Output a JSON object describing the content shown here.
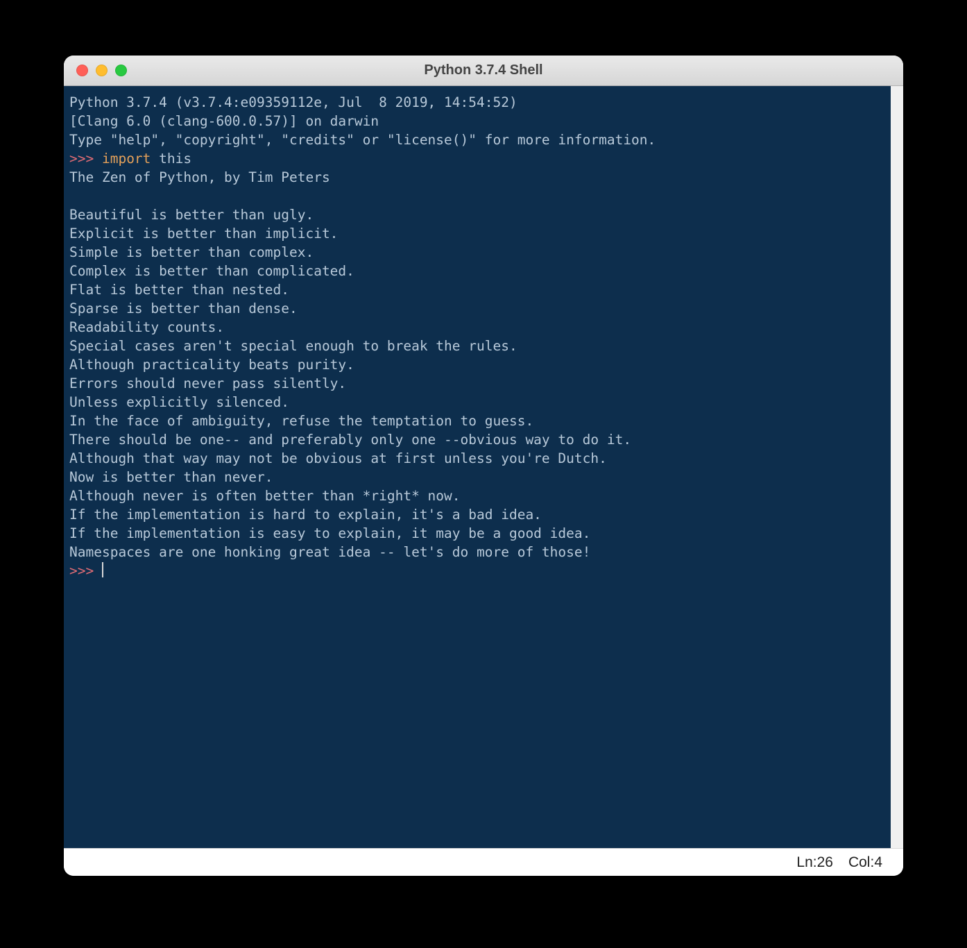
{
  "window": {
    "title": "Python 3.7.4 Shell"
  },
  "terminal": {
    "header": [
      "Python 3.7.4 (v3.7.4:e09359112e, Jul  8 2019, 14:54:52)",
      "[Clang 6.0 (clang-600.0.57)] on darwin",
      "Type \"help\", \"copyright\", \"credits\" or \"license()\" for more information."
    ],
    "prompt": ">>> ",
    "input_kw": "import",
    "input_rest": " this",
    "output": [
      "The Zen of Python, by Tim Peters",
      "",
      "Beautiful is better than ugly.",
      "Explicit is better than implicit.",
      "Simple is better than complex.",
      "Complex is better than complicated.",
      "Flat is better than nested.",
      "Sparse is better than dense.",
      "Readability counts.",
      "Special cases aren't special enough to break the rules.",
      "Although practicality beats purity.",
      "Errors should never pass silently.",
      "Unless explicitly silenced.",
      "In the face of ambiguity, refuse the temptation to guess.",
      "There should be one-- and preferably only one --obvious way to do it.",
      "Although that way may not be obvious at first unless you're Dutch.",
      "Now is better than never.",
      "Although never is often better than *right* now.",
      "If the implementation is hard to explain, it's a bad idea.",
      "If the implementation is easy to explain, it may be a good idea.",
      "Namespaces are one honking great idea -- let's do more of those!"
    ],
    "prompt2": ">>> "
  },
  "statusbar": {
    "ln_label": "Ln: ",
    "ln_value": "26",
    "col_label": "Col: ",
    "col_value": "4"
  }
}
